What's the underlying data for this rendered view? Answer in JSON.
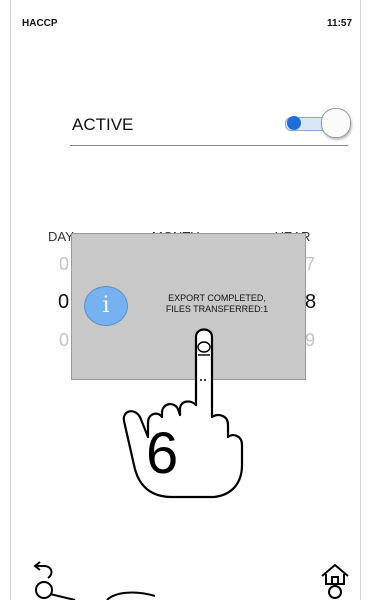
{
  "status_bar": {
    "title": "HACCP",
    "time": "11:57"
  },
  "active": {
    "label": "ACTIVE",
    "toggle_on": true
  },
  "date_picker": {
    "day_label": "DAY",
    "month_label": "MONTH",
    "year_label": "YEAR",
    "day": {
      "prev": "0",
      "current": "0",
      "next": "0"
    },
    "year": {
      "prev": "7",
      "current": "8",
      "next": "9"
    }
  },
  "dialog": {
    "icon": "info-icon",
    "line1": "EXPORT COMPLETED,",
    "line2": "FILES TRANSFERRED:1"
  },
  "instruction": {
    "step": "6",
    "gesture": "tap-hand-icon"
  },
  "bottom_bar": {
    "left_icon": "back-arrow-icon",
    "right_icon": "home-icon"
  }
}
